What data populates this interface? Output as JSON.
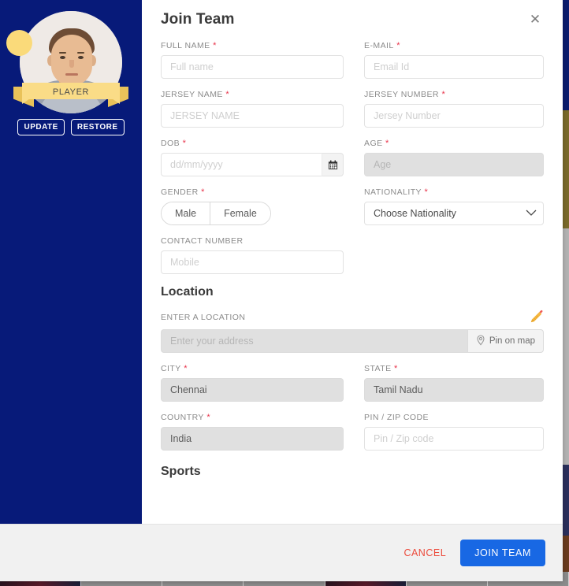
{
  "sidebar": {
    "avatar_alt": "player-avatar",
    "ribbon_label": "PLAYER",
    "update_label": "UPDATE",
    "restore_label": "RESTORE"
  },
  "header": {
    "title": "Join Team",
    "close_label": "✕"
  },
  "form": {
    "full_name": {
      "label": "FULL NAME",
      "required": true,
      "placeholder": "Full name",
      "value": ""
    },
    "email": {
      "label": "E-MAIL",
      "required": true,
      "placeholder": "Email Id",
      "value": ""
    },
    "jersey_name": {
      "label": "JERSEY NAME",
      "required": true,
      "placeholder": "JERSEY NAME",
      "value": ""
    },
    "jersey_number": {
      "label": "JERSEY NUMBER",
      "required": true,
      "placeholder": "Jersey Number",
      "value": ""
    },
    "dob": {
      "label": "DOB",
      "required": true,
      "placeholder": "dd/mm/yyyy",
      "value": ""
    },
    "age": {
      "label": "AGE",
      "required": true,
      "placeholder": "Age",
      "value": "",
      "disabled": true
    },
    "gender": {
      "label": "GENDER",
      "required": true,
      "options": [
        "Male",
        "Female"
      ],
      "selected": "Male"
    },
    "nationality": {
      "label": "NATIONALITY",
      "required": true,
      "selected": "Choose Nationality"
    },
    "contact_number": {
      "label": "CONTACT NUMBER",
      "required": false,
      "placeholder": "Mobile",
      "value": ""
    }
  },
  "location": {
    "section_title": "Location",
    "enter_location_label": "ENTER A LOCATION",
    "edit_icon": "pencil-icon",
    "address": {
      "placeholder": "Enter your address",
      "value": "",
      "disabled": true
    },
    "pin_on_map_label": "Pin on map",
    "city": {
      "label": "CITY",
      "required": true,
      "value": "Chennai",
      "disabled": true
    },
    "state": {
      "label": "STATE",
      "required": true,
      "value": "Tamil Nadu",
      "disabled": true
    },
    "country": {
      "label": "COUNTRY",
      "required": true,
      "value": "India",
      "disabled": true
    },
    "zip": {
      "label": "PIN / ZIP CODE",
      "required": false,
      "placeholder": "Pin / Zip code",
      "value": ""
    }
  },
  "sports": {
    "section_title": "Sports"
  },
  "footer": {
    "cancel_label": "CANCEL",
    "submit_label": "JOIN TEAM"
  },
  "colors": {
    "sidebar_bg": "#071a79",
    "accent_blue": "#1868e4",
    "cancel_red": "#ec4a3b",
    "required_red": "#e8334a",
    "ribbon_yellow": "#fadc87",
    "badge_yellow": "#fada7a"
  }
}
